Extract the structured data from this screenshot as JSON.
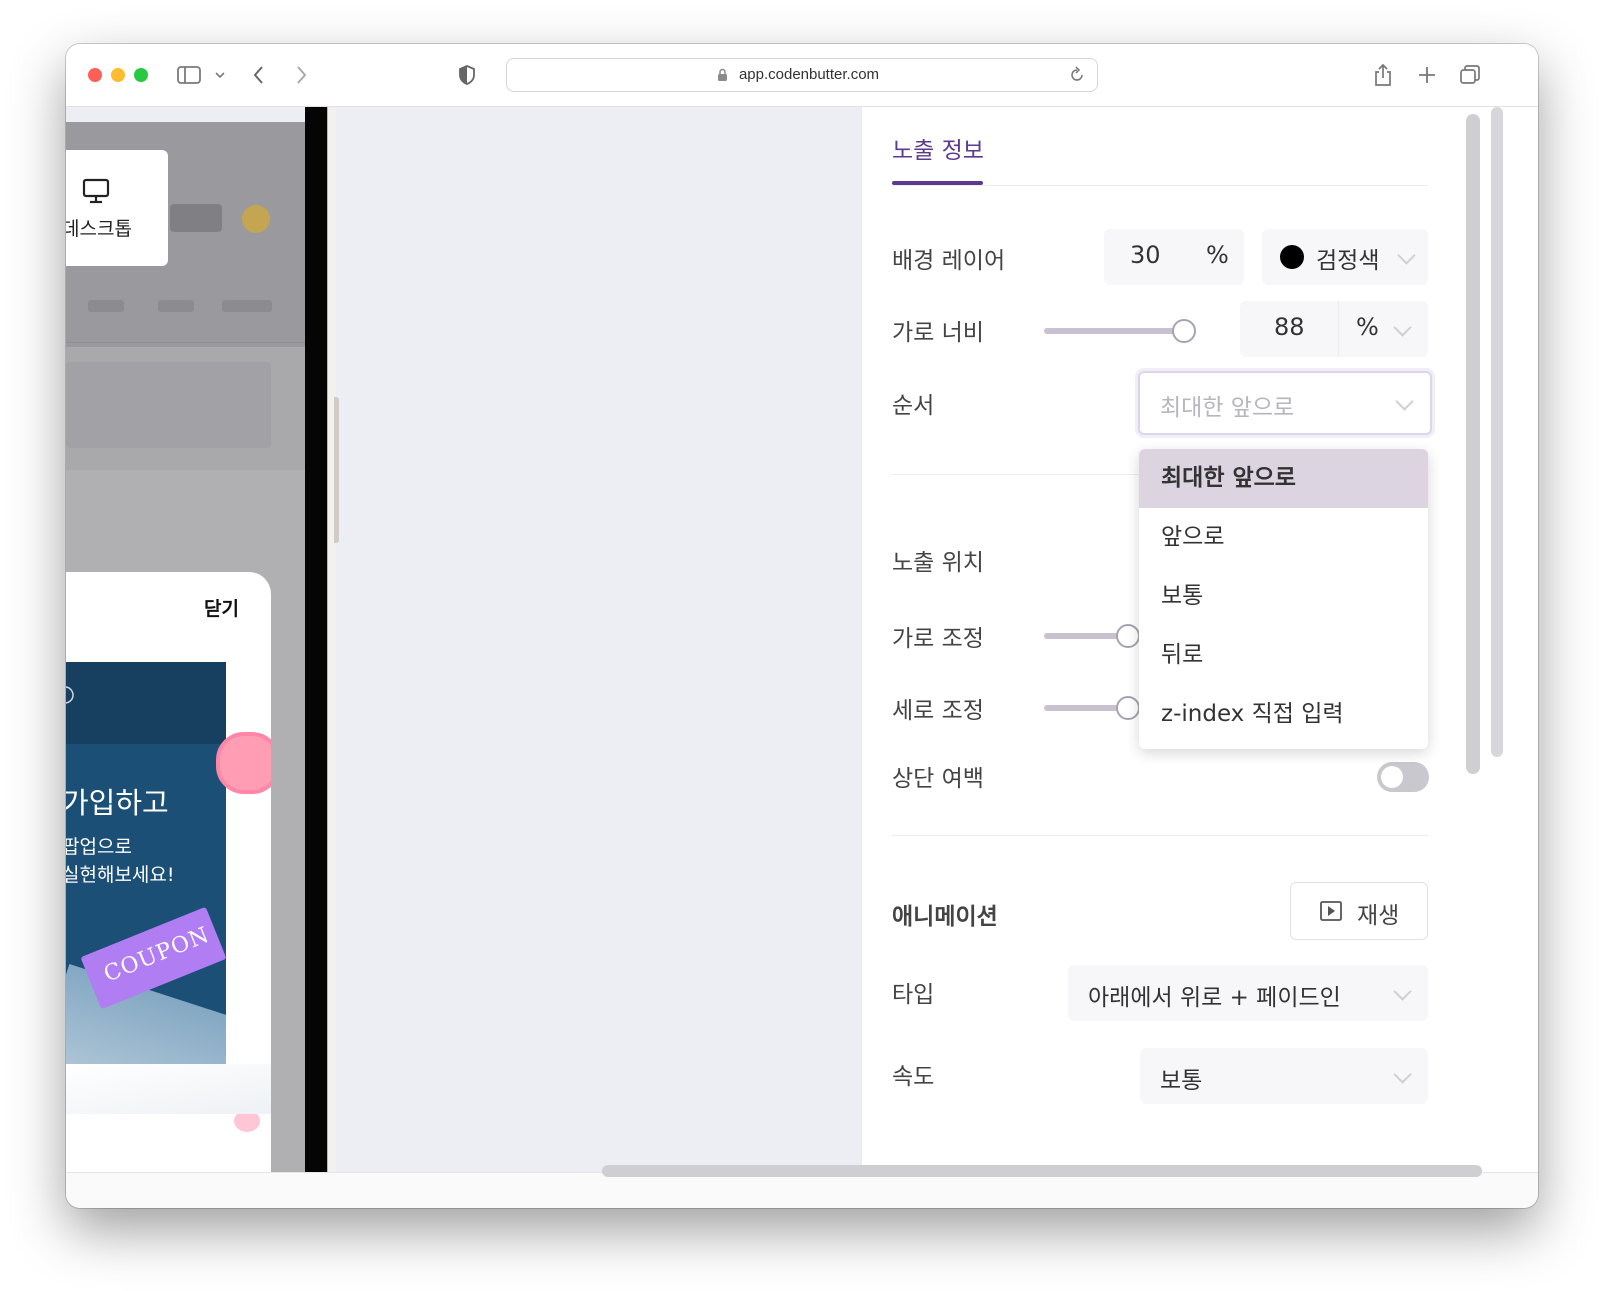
{
  "browser": {
    "url": "app.codenbutter.com"
  },
  "preview": {
    "device_label": "데스크톱",
    "close_label": "닫기",
    "banner_title": "가입하고",
    "banner_line1": "팝업으로",
    "banner_line2": "실현해보세요!",
    "coupon_text": "COUPON"
  },
  "panel": {
    "tab_label": "노출 정보",
    "background_layer": {
      "label": "배경 레이어",
      "value": "30",
      "unit": "%",
      "color_name": "검정색",
      "color": "#000000"
    },
    "width": {
      "label": "가로 너비",
      "value": "88",
      "unit": "%",
      "slider_fraction": 0.88
    },
    "order": {
      "label": "순서",
      "selected": "최대한 앞으로",
      "options": [
        "최대한 앞으로",
        "앞으로",
        "보통",
        "뒤로",
        "z-index 직접 입력"
      ]
    },
    "position": {
      "label": "노출 위치"
    },
    "horizontal_adjust": {
      "label": "가로 조정"
    },
    "vertical_adjust": {
      "label": "세로 조정"
    },
    "top_margin": {
      "label": "상단 여백",
      "enabled": false
    },
    "animation": {
      "section_title": "애니메이션",
      "play_label": "재생",
      "type_label": "타입",
      "type_value": "아래에서 위로 + 페이드인",
      "speed_label": "속도",
      "speed_value": "보통"
    }
  },
  "colors": {
    "accent": "#5b3a8f",
    "menu_highlight": "#dcd5e1"
  }
}
